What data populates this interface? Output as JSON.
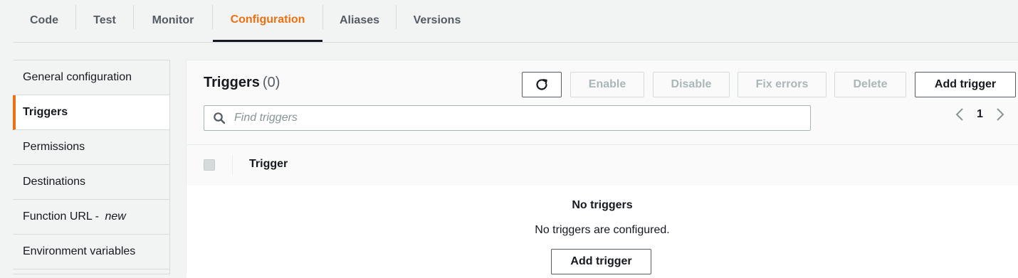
{
  "tabs": [
    {
      "label": "Code"
    },
    {
      "label": "Test"
    },
    {
      "label": "Monitor"
    },
    {
      "label": "Configuration",
      "active": true
    },
    {
      "label": "Aliases"
    },
    {
      "label": "Versions"
    }
  ],
  "sidebar": {
    "items": [
      {
        "label": "General configuration"
      },
      {
        "label": "Triggers",
        "active": true
      },
      {
        "label": "Permissions"
      },
      {
        "label": "Destinations"
      },
      {
        "label": "Function URL - ",
        "suffix": "new"
      },
      {
        "label": "Environment variables"
      }
    ]
  },
  "panel": {
    "title": "Triggers",
    "count": "(0)",
    "buttons": {
      "refresh_icon": "refresh-icon",
      "enable": "Enable",
      "disable": "Disable",
      "fix_errors": "Fix errors",
      "delete": "Delete",
      "add_trigger": "Add trigger"
    },
    "search": {
      "placeholder": "Find triggers",
      "icon": "search-icon"
    },
    "pagination": {
      "page": "1"
    },
    "table": {
      "columns": [
        "Trigger"
      ]
    },
    "empty": {
      "title": "No triggers",
      "description": "No triggers are configured.",
      "button": "Add trigger"
    }
  },
  "colors": {
    "accent": "#ec7211",
    "text": "#16191f",
    "disabled": "#aab7b8"
  }
}
